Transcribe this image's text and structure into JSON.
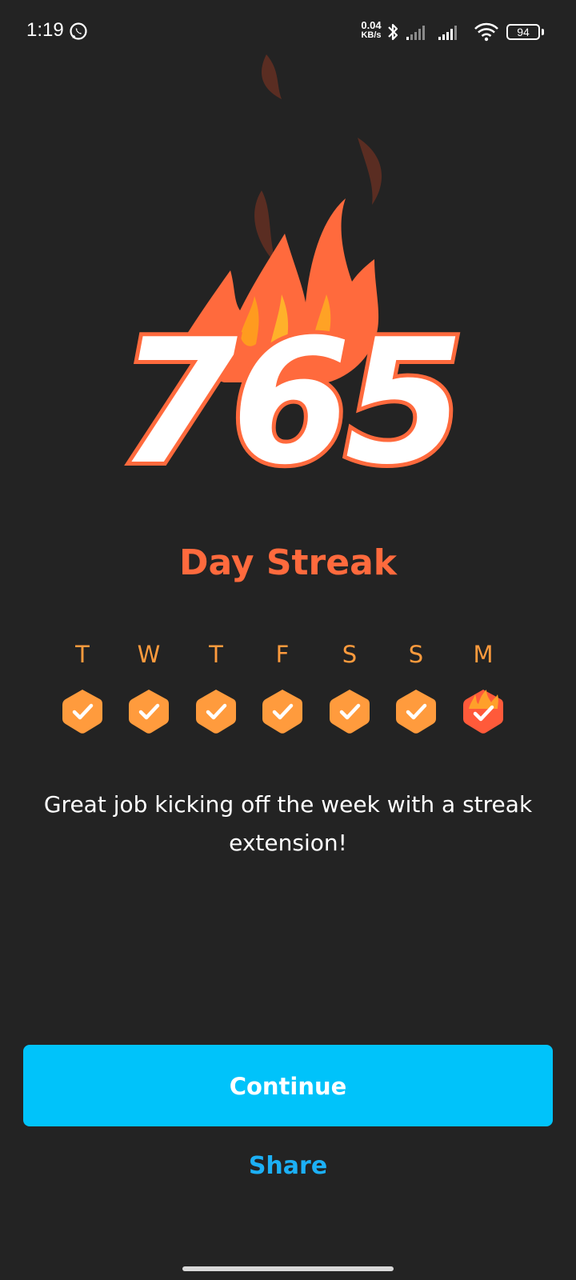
{
  "status_bar": {
    "time": "1:19",
    "net_speed_value": "0.04",
    "net_speed_unit": "KB/s",
    "battery": "94",
    "icons": [
      "whatsapp-icon",
      "bluetooth-icon",
      "signal-icon",
      "signal-icon",
      "wifi-icon",
      "battery-icon"
    ]
  },
  "streak": {
    "count": "765",
    "label": "Day Streak"
  },
  "week": {
    "days": [
      {
        "letter": "T",
        "status": "check"
      },
      {
        "letter": "W",
        "status": "check"
      },
      {
        "letter": "T",
        "status": "check"
      },
      {
        "letter": "F",
        "status": "check"
      },
      {
        "letter": "S",
        "status": "check"
      },
      {
        "letter": "S",
        "status": "check"
      },
      {
        "letter": "M",
        "status": "fire-check"
      }
    ]
  },
  "message": "Great job kicking off the week with a streak extension!",
  "actions": {
    "continue_label": "Continue",
    "share_label": "Share"
  },
  "colors": {
    "background": "#232323",
    "flame": "#ff6a3d",
    "flame_light": "#ff9b3d",
    "flame_dark": "#5a2d22",
    "badge": "#ff9b3d",
    "primary_button": "#00c3fa",
    "link": "#1cb0f6"
  }
}
